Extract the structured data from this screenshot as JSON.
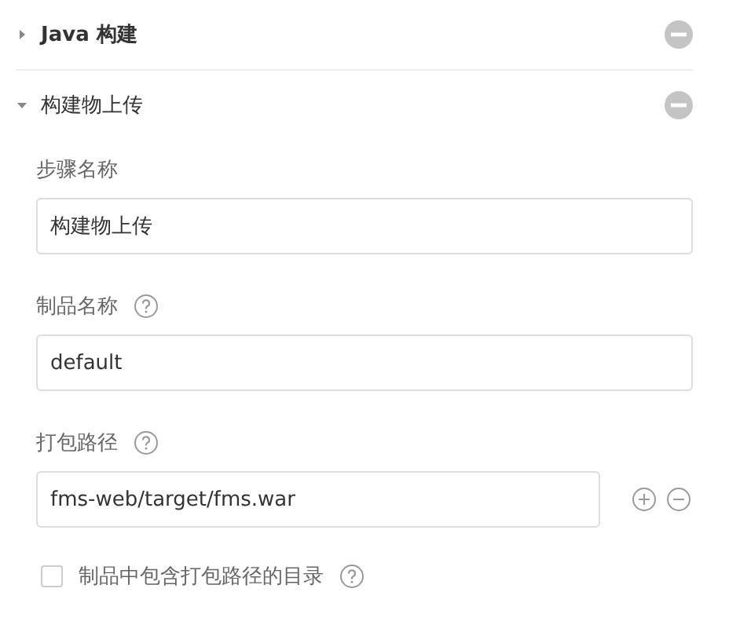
{
  "sections": [
    {
      "title": "Java 构建",
      "expanded": false
    },
    {
      "title": "构建物上传",
      "expanded": true
    }
  ],
  "fields": [
    {
      "kind": "text",
      "label": "步骤名称",
      "help": false,
      "value": "构建物上传"
    },
    {
      "kind": "text",
      "label": "制品名称",
      "help": true,
      "value": "default"
    },
    {
      "kind": "path",
      "label": "打包路径",
      "help": true,
      "value": "fms-web/target/fms.war"
    }
  ],
  "option": {
    "label": "制品中包含打包路径的目录",
    "checked": false,
    "help": true
  }
}
